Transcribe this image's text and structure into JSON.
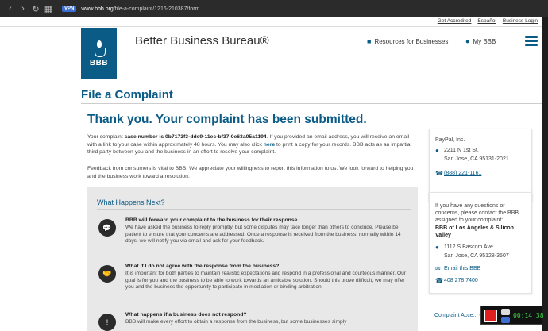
{
  "browser": {
    "vpn_badge": "VPN",
    "url_domain": "www.bbb.org",
    "url_path": "/file-a-complaint/1216-210387/form"
  },
  "toplinks": [
    "Get Accredited",
    "Español",
    "Business Login"
  ],
  "header": {
    "logo_text": "BBB",
    "brand": "Better Business Bureau®",
    "resources_label": "Resources for Businesses",
    "mybbb_label": "My BBB"
  },
  "main": {
    "page_title": "File a Complaint",
    "thanks_heading": "Thank you. Your complaint has been submitted.",
    "p1_a": "Your complaint ",
    "p1_case_label": "case number is 0b7173f3-dde9-11ec-bf37-0e63a05a1194",
    "p1_b": ". If you provided an email address, you will receive an email with a link to your case within approximately 48 hours. You may also click ",
    "p1_here": "here",
    "p1_c": " to print a copy for your records. BBB acts as an impartial third party between you and the business in an effort to resolve your complaint.",
    "p2": "Feedback from consumers is vital to BBB. We appreciate your willingness to report this information to us. We look forward to helping you and the business work toward a resolution.",
    "what_happens": {
      "title": "What Happens Next?",
      "steps": [
        {
          "heading": "BBB will forward your complaint to the business for their response.",
          "text": "We have asked the business to reply promptly, but some disputes may take longer than others to conclude. Please be patient to ensure that your concerns are addressed. Once a response is received from the business, normally within 14 days, we will notify you via email and ask for your feedback."
        },
        {
          "heading": "What if I do not agree with the response from the business?",
          "text": "It is important for both parties to maintain realistic expectations and respond in a professional and courteous manner. Our goal is for you and the business to be able to work towards an amicable solution. Should this prove difficult, we may offer you and the business the opportunity to participate in mediation or binding arbitration."
        },
        {
          "heading": "What happens if a business does not respond?",
          "text": "BBB will make every effort to obtain a response from the business, but some businesses simply"
        }
      ]
    }
  },
  "sidebar": {
    "business_card": {
      "name": "PayPal, Inc.",
      "street": "2211 N 1st St,",
      "city": "San Jose, CA 95131-2021",
      "phone": "(888) 221-1161"
    },
    "bbb_card": {
      "intro": "If you have any questions or concerns, please contact the BBB assigned to your complaint:",
      "bbb_name": "BBB of Los Angeles & Silicon Valley",
      "street": "1112 S Bascom Ave",
      "city": "San Jose, CA 95128-3507",
      "email_link": "Email this BBB",
      "phone": "408 278 7400"
    },
    "guidelines_link": "Complaint Acce... Guidelines"
  },
  "recorder": {
    "time": "00:14:38"
  }
}
